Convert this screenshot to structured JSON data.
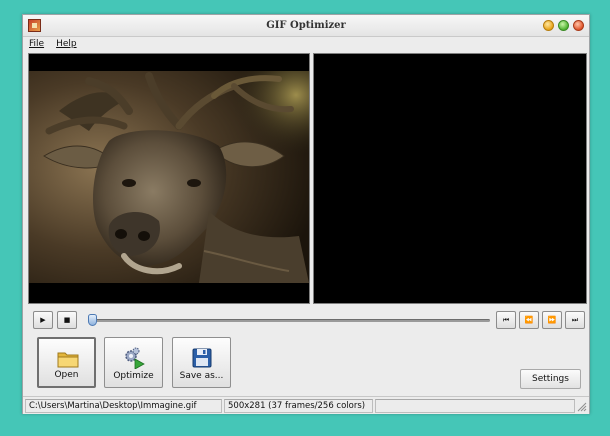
{
  "window": {
    "title": "GIF Optimizer",
    "icons": {
      "app": "gif-optimizer-app-icon",
      "minimize": "minimize-icon",
      "maximize": "maximize-icon",
      "close": "close-icon"
    }
  },
  "menu": [
    {
      "label": "File"
    },
    {
      "label": "Help"
    }
  ],
  "preview": {
    "original_image": "deer-photo",
    "optimized_image": "empty-black-preview"
  },
  "playback": {
    "play_icon": "play-icon",
    "stop_icon": "stop-icon",
    "first_icon": "first-frame-icon",
    "prev_icon": "previous-frame-icon",
    "next_icon": "next-frame-icon",
    "last_icon": "last-frame-icon",
    "play_symbol": "▶",
    "stop_symbol": "■",
    "first_symbol": "⏮",
    "prev_symbol": "⏪",
    "next_symbol": "⏩",
    "last_symbol": "⏭",
    "position_fraction": 0.0
  },
  "actions": {
    "open_label": "Open",
    "optimize_label": "Optimize",
    "save_label": "Save as...",
    "settings_label": "Settings"
  },
  "status": {
    "path": "C:\\Users\\Martina\\Desktop\\Immagine.gif",
    "info": "500x281 (37 frames/256 colors)",
    "extra": ""
  },
  "colors": {
    "desktop": "#45c6b7",
    "window_bg": "#ececec",
    "accent": "#4c79b3"
  }
}
